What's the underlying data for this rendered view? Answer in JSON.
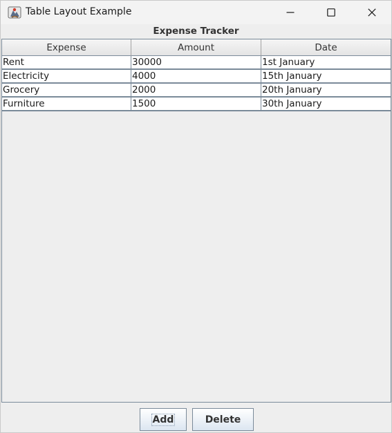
{
  "window": {
    "title": "Table Layout Example"
  },
  "heading": "Expense Tracker",
  "table": {
    "columns": [
      "Expense",
      "Amount",
      "Date"
    ],
    "rows": [
      [
        "Rent",
        "30000",
        "1st January"
      ],
      [
        "Electricity",
        "4000",
        "15th January"
      ],
      [
        "Grocery",
        "2000",
        "20th January"
      ],
      [
        "Furniture",
        "1500",
        "30th January"
      ]
    ]
  },
  "buttons": {
    "add_label": "Add",
    "delete_label": "Delete"
  },
  "icons": {
    "app": "java-app-icon",
    "minimize": "minimize-icon",
    "maximize": "maximize-icon",
    "close": "close-icon"
  },
  "colors": {
    "background": "#eeeeee",
    "grid": "#7a8a99",
    "button_gradient_bottom": "#dce6f1"
  }
}
